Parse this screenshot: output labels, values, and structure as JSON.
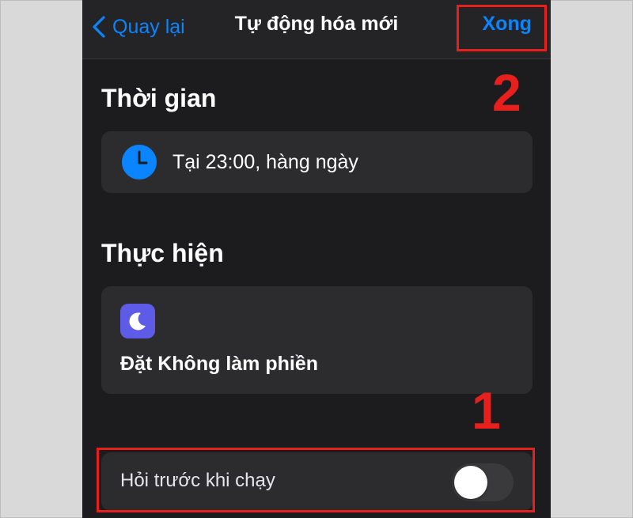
{
  "nav": {
    "back_label": "Quay lại",
    "title": "Tự động hóa mới",
    "done_label": "Xong"
  },
  "sections": {
    "time_title": "Thời gian",
    "time_value": "Tại 23:00, hàng ngày",
    "action_title": "Thực hiện",
    "action_value": "Đặt Không làm phiền"
  },
  "ask_before_run": {
    "label": "Hỏi trước khi chạy",
    "enabled": false
  },
  "annotations": {
    "step_1": "1",
    "step_2": "2"
  },
  "icons": {
    "back": "chevron-left-icon",
    "clock": "clock-icon",
    "moon": "moon-icon"
  },
  "colors": {
    "accent": "#0a84ff",
    "background": "#1c1c1e",
    "card": "#2c2c2e",
    "annotation": "#e8201d",
    "moon_tile": "#5e5ce6"
  }
}
